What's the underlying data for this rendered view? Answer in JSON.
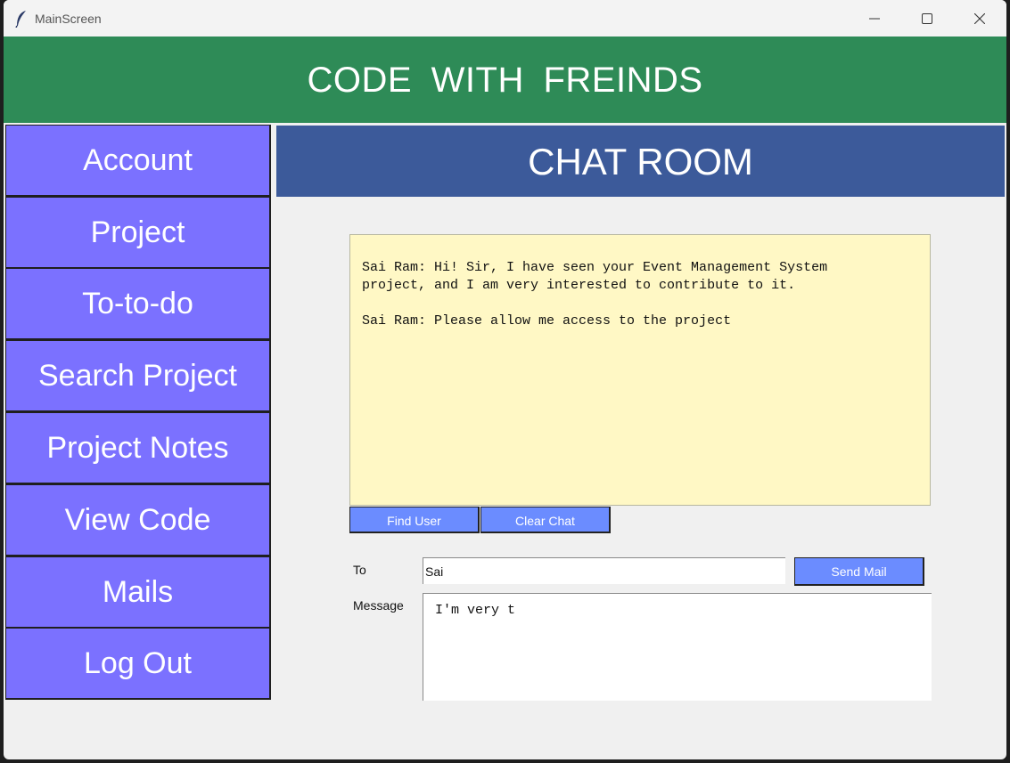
{
  "window": {
    "title": "MainScreen",
    "app_icon": "feather-icon",
    "controls": [
      "minimize-icon",
      "maximize-icon",
      "close-icon"
    ]
  },
  "header": {
    "title": "CODE  WITH  FREINDS",
    "color": "#2e8b57"
  },
  "sidebar": {
    "color": "#7b71ff",
    "items": [
      {
        "label": "Account"
      },
      {
        "label": "Project"
      },
      {
        "label": "To-to-do"
      },
      {
        "label": "Search Project"
      },
      {
        "label": "Project Notes"
      },
      {
        "label": "View Code"
      },
      {
        "label": "Mails"
      },
      {
        "label": "Log Out"
      }
    ]
  },
  "chat_room": {
    "title": "CHAT ROOM",
    "header_color": "#3c5a9a",
    "messages": [
      "Sai Ram: Hi! Sir, I have seen your Event Management System\nproject, and I am very interested to contribute to it.",
      "Sai Ram: Please allow me access to the project"
    ],
    "buttons": {
      "find_user": "Find User",
      "clear_chat": "Clear Chat"
    }
  },
  "mail": {
    "to_label": "To",
    "to_value": "Sai",
    "send_label": "Send Mail",
    "message_label": "Message",
    "message_value": "I'm very t"
  }
}
